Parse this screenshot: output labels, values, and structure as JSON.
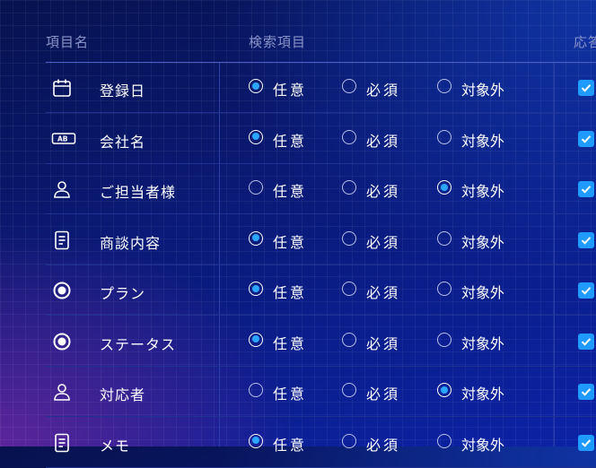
{
  "header": {
    "col_name": "項目名",
    "col_search": "検索項目",
    "col_response": "応答"
  },
  "options": [
    "任意",
    "必須",
    "対象外"
  ],
  "rows": [
    {
      "icon": "calendar-icon",
      "label": "登録日",
      "selected": "任意",
      "checked": true
    },
    {
      "icon": "ab-badge-icon",
      "label": "会社名",
      "selected": "任意",
      "checked": true
    },
    {
      "icon": "person-icon",
      "label": "ご担当者様",
      "selected": "対象外",
      "checked": true
    },
    {
      "icon": "document-icon",
      "label": "商談内容",
      "selected": "任意",
      "checked": true
    },
    {
      "icon": "radio-circle-icon",
      "label": "プラン",
      "selected": "任意",
      "checked": true
    },
    {
      "icon": "radio-circle-icon",
      "label": "ステータス",
      "selected": "任意",
      "checked": true
    },
    {
      "icon": "person-icon",
      "label": "対応者",
      "selected": "対象外",
      "checked": true
    },
    {
      "icon": "document-icon",
      "label": "メモ",
      "selected": "任意",
      "checked": true
    }
  ],
  "colors": {
    "accent": "#2aa6ff",
    "checkbox": "#1f9bff",
    "background_top": "#07124f",
    "background_bottom": "#0c22a6",
    "header_text": "#8a93c8"
  }
}
